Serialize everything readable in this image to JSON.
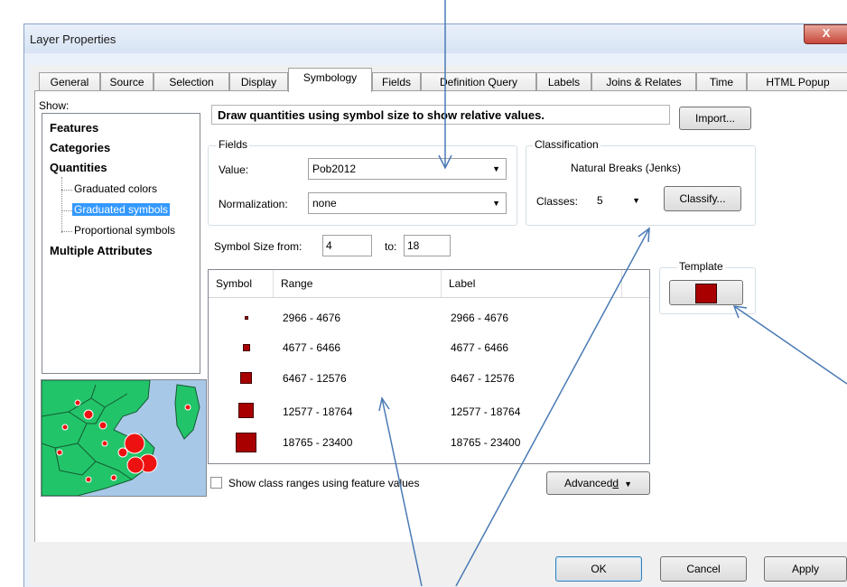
{
  "window": {
    "title": "Layer Properties",
    "close_label": "X"
  },
  "tabs": [
    "General",
    "Source",
    "Selection",
    "Display",
    "Symbology",
    "Fields",
    "Definition Query",
    "Labels",
    "Joins & Relates",
    "Time",
    "HTML Popup"
  ],
  "active_tab": "Symbology",
  "show": {
    "label": "Show:",
    "items": [
      {
        "label": "Features"
      },
      {
        "label": "Categories"
      },
      {
        "label": "Quantities"
      },
      {
        "label": "Graduated colors"
      },
      {
        "label": "Graduated symbols",
        "selected": true
      },
      {
        "label": "Proportional symbols"
      },
      {
        "label": "Multiple Attributes"
      }
    ]
  },
  "description": "Draw quantities using symbol size to show relative values.",
  "import_label": "Import...",
  "fields": {
    "group_label": "Fields",
    "value_label": "Value:",
    "value": "Pob2012",
    "normalization_label": "Normalization:",
    "normalization": "none"
  },
  "classification": {
    "group_label": "Classification",
    "method": "Natural Breaks (Jenks)",
    "classes_label": "Classes:",
    "classes": "5",
    "classify_label": "Classify..."
  },
  "symbol_size": {
    "from_label": "Symbol Size from:",
    "from": "4",
    "to_label": "to:",
    "to": "18"
  },
  "template": {
    "label": "Template",
    "color": "#a80000"
  },
  "table": {
    "headers": [
      "Symbol",
      "Range",
      "Label"
    ],
    "rows": [
      {
        "range": "2966 - 4676",
        "label": "2966 - 4676"
      },
      {
        "range": "4677 - 6466",
        "label": "4677 - 6466"
      },
      {
        "range": "6467 - 12576",
        "label": "6467 - 12576"
      },
      {
        "range": "12577 - 18764",
        "label": "12577 - 18764"
      },
      {
        "range": "18765 - 23400",
        "label": "18765 - 23400"
      }
    ]
  },
  "show_class_ranges_label": "Show class ranges using feature values",
  "advanced_label": "Advanced",
  "advanced_hotkey": "d",
  "buttons": {
    "ok": "OK",
    "cancel": "Cancel",
    "apply": "Apply"
  },
  "colors": {
    "symbol": "#a80000",
    "selection": "#3399ff",
    "annotation_arrow": "#4a7ab5"
  }
}
